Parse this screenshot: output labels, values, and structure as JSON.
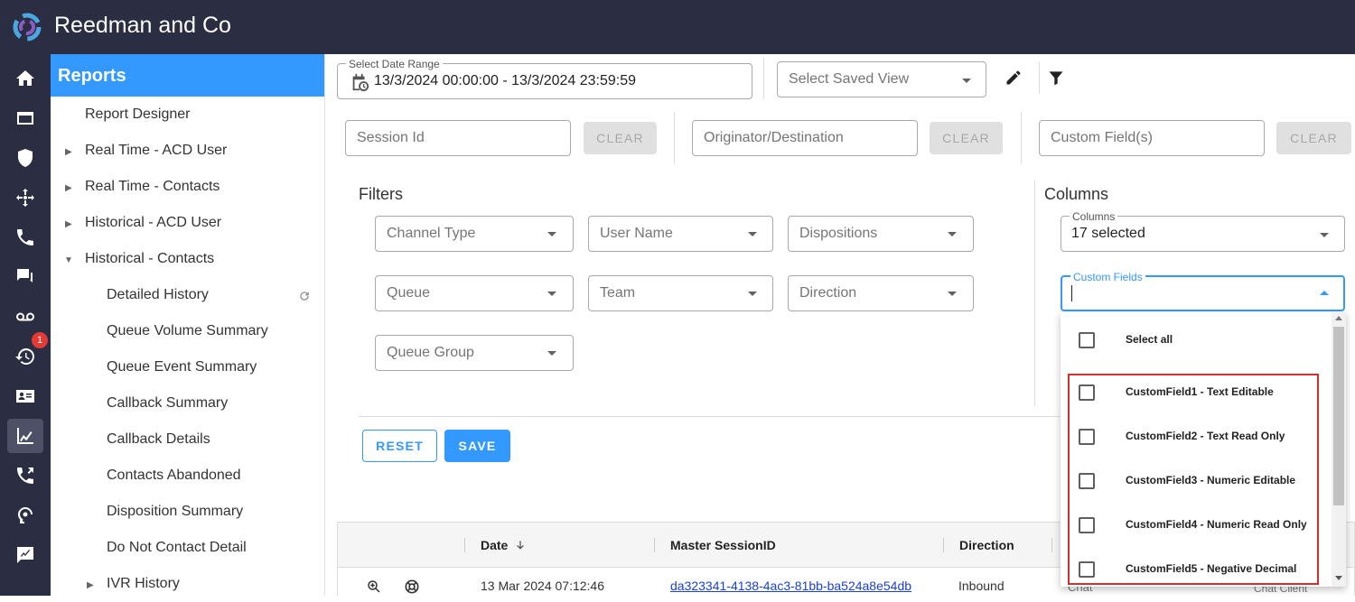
{
  "app": {
    "title": "Reedman and Co"
  },
  "rail": {
    "badge_count": "1"
  },
  "sidenav": {
    "header": "Reports",
    "items": [
      {
        "label": "Report Designer"
      },
      {
        "label": "Real Time - ACD User"
      },
      {
        "label": "Real Time - Contacts"
      },
      {
        "label": "Historical - ACD User"
      },
      {
        "label": "Historical - Contacts"
      },
      {
        "label": "Detailed History"
      },
      {
        "label": "Queue Volume Summary"
      },
      {
        "label": "Queue Event Summary"
      },
      {
        "label": "Callback Summary"
      },
      {
        "label": "Callback Details"
      },
      {
        "label": "Contacts Abandoned"
      },
      {
        "label": "Disposition Summary"
      },
      {
        "label": "Do Not Contact Detail"
      },
      {
        "label": "IVR History"
      }
    ]
  },
  "toolbar": {
    "date_range_label": "Select Date Range",
    "date_range_value": "13/3/2024 00:00:00 - 13/3/2024 23:59:59",
    "saved_view_placeholder": "Select Saved View"
  },
  "search": {
    "session_id_placeholder": "Session Id",
    "originator_placeholder": "Originator/Destination",
    "custom_field_placeholder": "Custom Field(s)",
    "clear_label": "CLEAR"
  },
  "filters": {
    "title": "Filters",
    "channel_type": "Channel Type",
    "user_name": "User Name",
    "dispositions": "Dispositions",
    "queue": "Queue",
    "team": "Team",
    "direction": "Direction",
    "queue_group": "Queue Group"
  },
  "columns": {
    "title": "Columns",
    "columns_label": "Columns",
    "columns_value": "17 selected",
    "custom_fields_label": "Custom Fields",
    "options": [
      {
        "label": "Select all"
      },
      {
        "label": "CustomField1 - Text Editable"
      },
      {
        "label": "CustomField2 - Text Read Only"
      },
      {
        "label": "CustomField3 - Numeric Editable"
      },
      {
        "label": "CustomField4 - Numeric Read Only"
      },
      {
        "label": "CustomField5 - Negative Decimal"
      }
    ]
  },
  "actions": {
    "reset_label": "RESET",
    "save_label": "SAVE"
  },
  "grid": {
    "headers": {
      "date": "Date",
      "master_session_id": "Master SessionID",
      "direction": "Direction"
    },
    "row": {
      "date": "13 Mar 2024 07:12:46",
      "master_session_id": "da323341-4138-4ac3-81bb-ba524a8e54db",
      "direction": "Inbound",
      "channel": "Chat",
      "client": "Chat Client"
    }
  },
  "colors": {
    "accent": "#3399ff",
    "topbar": "#2b2d42",
    "highlight": "#d32f2f",
    "badge": "#e53935"
  }
}
